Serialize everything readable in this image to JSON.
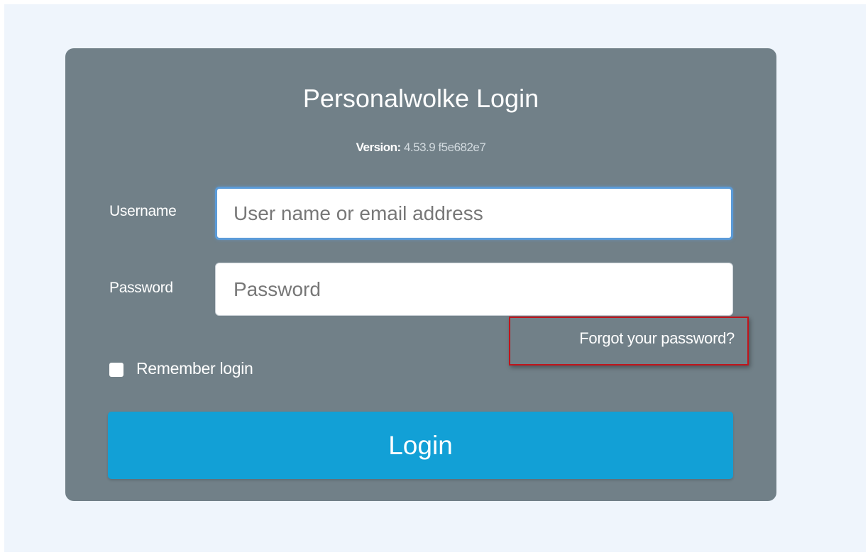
{
  "login": {
    "title": "Personalwolke Login",
    "version_label": "Version:",
    "version_value": "4.53.9 f5e682e7",
    "username": {
      "label": "Username",
      "placeholder": "User name or email address",
      "value": ""
    },
    "password": {
      "label": "Password",
      "placeholder": "Password",
      "value": ""
    },
    "forgot_password": "Forgot your password?",
    "remember_login": {
      "label": "Remember login",
      "checked": false
    },
    "submit_label": "Login"
  },
  "colors": {
    "page_background": "#eff5fc",
    "card_background": "#718088",
    "button_background": "#12a0d6",
    "highlight_border": "#c0141b",
    "focus_border": "#5b9bd8"
  }
}
